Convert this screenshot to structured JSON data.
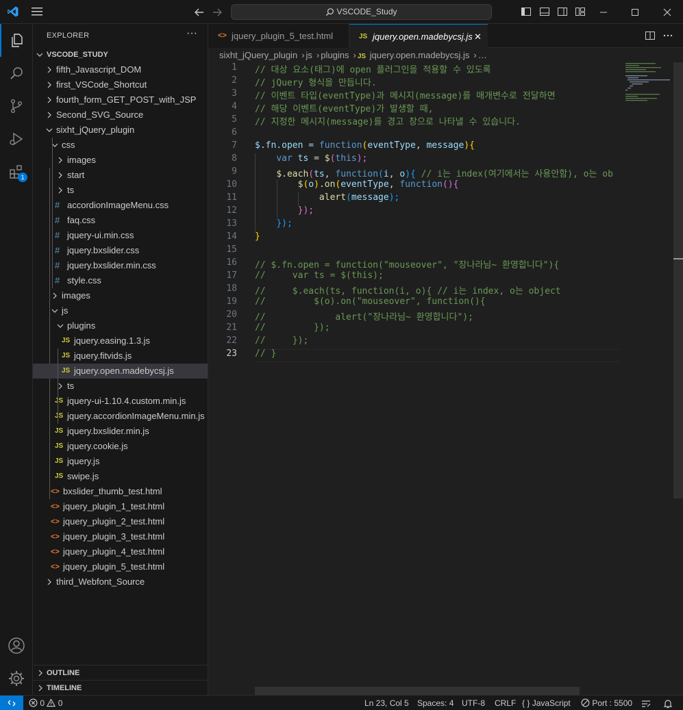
{
  "titlebar": {
    "search_text": "VSCODE_Study"
  },
  "activity": {
    "extensions_badge": "1"
  },
  "sidebar": {
    "title": "EXPLORER",
    "more": "···",
    "root": "VSCODE_STUDY",
    "items": [
      "fifth_Javascript_DOM",
      "first_VSCode_Shortcut",
      "fourth_form_GET_POST_with_JSP",
      "Second_SVG_Source",
      "sixht_jQuery_plugin",
      "css",
      "images",
      "start",
      "ts",
      "accordionImageMenu.css",
      "faq.css",
      "jquery-ui.min.css",
      "jquery.bxslider.css",
      "jquery.bxslider.min.css",
      "style.css",
      "images",
      "js",
      "plugins",
      "jquery.easing.1.3.js",
      "jquery.fitvids.js",
      "jquery.open.madebycsj.js",
      "ts",
      "jquery-ui-1.10.4.custom.min.js",
      "jquery.accordionImageMenu.min.js",
      "jquery.bxslider.min.js",
      "jquery.cookie.js",
      "jquery.js",
      "swipe.js",
      "bxslider_thumb_test.html",
      "jquery_plugin_1_test.html",
      "jquery_plugin_2_test.html",
      "jquery_plugin_3_test.html",
      "jquery_plugin_4_test.html",
      "jquery_plugin_5_test.html",
      "third_Webfont_Source"
    ],
    "js_icon": "JS",
    "css_icon": "#",
    "html_icon": "<>",
    "outline": "OUTLINE",
    "timeline": "TIMELINE"
  },
  "tabs": [
    {
      "label": "jquery_plugin_5_test.html",
      "icon": "<>"
    },
    {
      "label": "jquery.open.madebycsj.js",
      "icon": "JS",
      "close": "✕"
    }
  ],
  "breadcrumb": {
    "parts": [
      "sixht_jQuery_plugin",
      "js",
      "plugins",
      "jquery.open.madebycsj.js",
      "…"
    ],
    "sep": "›"
  },
  "code": {
    "line_numbers": [
      "1",
      "2",
      "3",
      "4",
      "5",
      "6",
      "7",
      "8",
      "9",
      "10",
      "11",
      "12",
      "13",
      "14",
      "15",
      "16",
      "17",
      "18",
      "19",
      "20",
      "21",
      "22",
      "23"
    ],
    "l1": "// 대상 요소(태그)에 open 플러그인을 적용할 수 있도록",
    "l2": "// jQuery 형식을 만듭니다.",
    "l3": "// 이벤트 타입(eventType)과 메시지(message)를 매개변수로 전달하면",
    "l4": "// 해당 이벤트(eventType)가 발생할 때,",
    "l5": "// 지정한 메시지(message)를 경고 창으로 나타낼 수 있습니다.",
    "l7a": "$.fn.open = ",
    "l7b": "function",
    "l7c": "(",
    "l7d": "eventType",
    "l7e": ", ",
    "l7f": "message",
    "l7g": "){",
    "l8a": "var",
    "l8b": " ts",
    "l8c": " = ",
    "l8d": "$",
    "l8e": "(",
    "l8f": "this",
    "l8g": ");",
    "l9a": "$.each",
    "l9b": "(",
    "l9c": "ts",
    "l9d": ", ",
    "l9e": "function",
    "l9f": "(",
    "l9g": "i",
    "l9h": ", ",
    "l9i": "o",
    "l9j": "){",
    "l9k": " // i는 index(여기에서는 사용안함), o는 ob",
    "l10a": "$",
    "l10b": "(",
    "l10c": "o",
    "l10d": ")",
    "l10e": ".on",
    "l10f": "(",
    "l10g": "eventType",
    "l10h": ", ",
    "l10i": "function",
    "l10j": "(){",
    "l11a": "alert",
    "l11b": "(",
    "l11c": "message",
    "l11d": ");",
    "l12": "});",
    "l13": "});",
    "l14": "}",
    "l16": "// $.fn.open = function(\"mouseover\", \"장나라님~ 환영합니다\"){",
    "l17": "//     var ts = $(this);",
    "l18": "//     $.each(ts, function(i, o){ // i는 index, o는 object",
    "l19": "//         $(o).on(\"mouseover\", function(){",
    "l20": "//             alert(\"장나라님~ 환영합니다\");",
    "l21": "//         });",
    "l22": "//     });",
    "l23": "// }"
  },
  "status": {
    "errors": "0",
    "warnings": "0",
    "position": "Ln 23, Col 5",
    "spaces": "Spaces: 4",
    "encoding": "UTF-8",
    "eol": "CRLF",
    "language_glyph": "{ }",
    "language": "JavaScript",
    "port": "Port : 5500"
  }
}
